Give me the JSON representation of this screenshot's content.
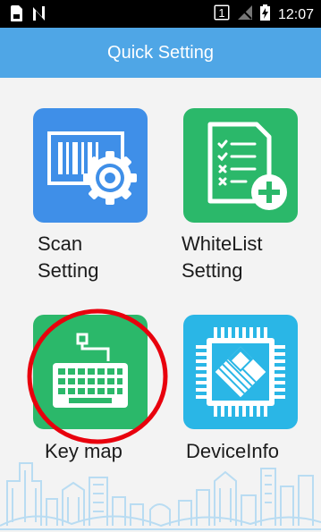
{
  "status_bar": {
    "time": "12:07",
    "sim_badge": "1",
    "icons": [
      "sim-card-icon",
      "nfc-icon",
      "sim-badge-icon",
      "no-signal-icon",
      "battery-charging-icon"
    ]
  },
  "header": {
    "title": "Quick Setting"
  },
  "tiles": [
    {
      "label_line1": "Scan",
      "label_line2": "Setting",
      "icon": "barcode-gear-icon",
      "color": "#3f8fe8"
    },
    {
      "label_line1": "WhiteList",
      "label_line2": "Setting",
      "icon": "checklist-add-icon",
      "color": "#2bb86a"
    },
    {
      "label": "Key map",
      "icon": "keyboard-icon",
      "color": "#2bb86a"
    },
    {
      "label": "DeviceInfo",
      "icon": "chip-icon",
      "color": "#2ab6e6"
    }
  ],
  "annotation": {
    "color": "#e8000d"
  }
}
